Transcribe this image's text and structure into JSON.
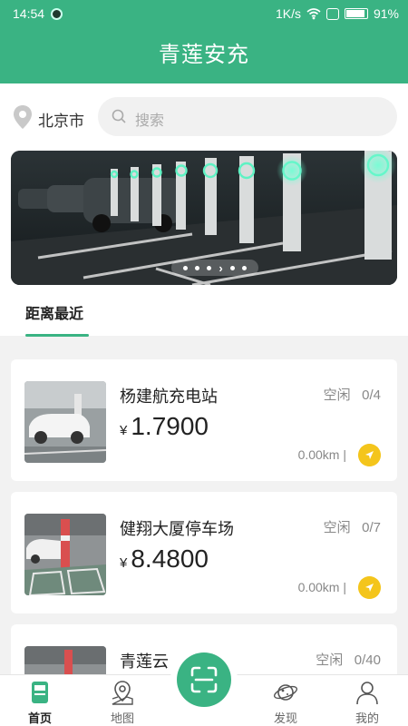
{
  "status_bar": {
    "time": "14:54",
    "network_speed": "1K/s",
    "battery_percent": "91%"
  },
  "header": {
    "title": "青莲安充"
  },
  "location": {
    "city": "北京市",
    "icon": "location-pin-icon"
  },
  "search": {
    "placeholder": "搜索",
    "icon": "search-icon"
  },
  "banner": {
    "page_count": 6,
    "active_index": 3
  },
  "tabs": [
    {
      "label": "距离最近",
      "active": true
    }
  ],
  "stations": [
    {
      "name": "杨建航充电站",
      "status": "空闲",
      "available": "0/4",
      "currency": "¥",
      "price": "1.7900",
      "distance": "0.00km |"
    },
    {
      "name": "健翔大厦停车场",
      "status": "空闲",
      "available": "0/7",
      "currency": "¥",
      "price": "8.4800",
      "distance": "0.00km |"
    },
    {
      "name": "青莲云",
      "status": "空闲",
      "available": "0/40"
    }
  ],
  "bottom_nav": [
    {
      "label": "首页",
      "icon": "home-icon",
      "active": true
    },
    {
      "label": "地图",
      "icon": "map-pin-icon",
      "active": false
    },
    {
      "label": "发现",
      "icon": "planet-icon",
      "active": false
    },
    {
      "label": "我的",
      "icon": "user-icon",
      "active": false
    }
  ],
  "scan_button": {
    "icon": "scan-icon"
  },
  "colors": {
    "brand": "#3ab383",
    "nav_button": "#f4c51c"
  }
}
